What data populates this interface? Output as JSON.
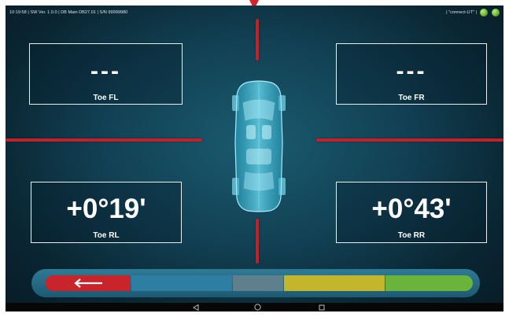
{
  "status": {
    "time": "10:19:58",
    "sw": "SW Ver. 1.0.0",
    "db": "DB Main DB27.01",
    "serial": "S/N 99999980",
    "connection": "\"connect-UT\""
  },
  "measurements": {
    "fl": {
      "value": "---",
      "label": "Toe FL"
    },
    "fr": {
      "value": "---",
      "label": "Toe FR"
    },
    "rl": {
      "value": "+0°19'",
      "label": "Toe RL"
    },
    "rr": {
      "value": "+0°43'",
      "label": "Toe RR"
    }
  },
  "toolbar": {
    "back_icon": "back-arrow-icon",
    "segments": [
      {
        "name": "red",
        "color": "#c9232c"
      },
      {
        "name": "blue",
        "color": "#2d7ea2"
      },
      {
        "name": "gray",
        "color": "#5f7f8c"
      },
      {
        "name": "yellow",
        "color": "#c4b62c"
      },
      {
        "name": "green",
        "color": "#6ab43c"
      }
    ]
  },
  "colors": {
    "accent_red": "#c3202a",
    "status_green": "#5aa41e"
  },
  "navbar": {
    "back_icon": "nav-back-icon",
    "home_icon": "nav-home-icon",
    "recents_icon": "nav-recents-icon"
  }
}
